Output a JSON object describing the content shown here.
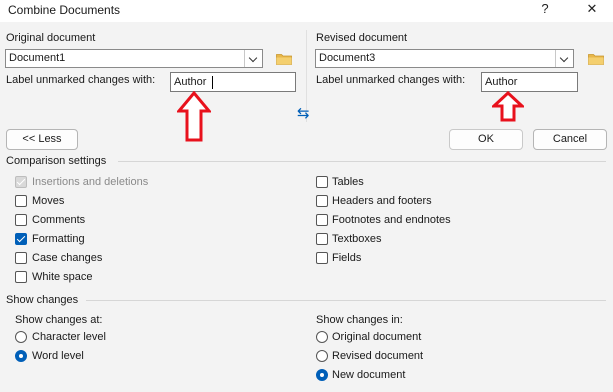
{
  "window": {
    "title": "Combine Documents",
    "help_glyph": "?",
    "close_glyph": "✕"
  },
  "original": {
    "section_label": "Original document",
    "document_value": "Document1",
    "label_prompt": "Label unmarked changes with:",
    "label_value": "Author"
  },
  "revised": {
    "section_label": "Revised document",
    "document_value": "Document3",
    "label_prompt": "Label unmarked changes with:",
    "label_value": "Author"
  },
  "swap_glyph": "⇆",
  "buttons": {
    "less": "<< Less",
    "ok": "OK",
    "cancel": "Cancel"
  },
  "comparison": {
    "heading": "Comparison settings",
    "left": [
      {
        "label": "Insertions and deletions",
        "checked": true,
        "disabled": true
      },
      {
        "label": "Moves",
        "checked": false
      },
      {
        "label": "Comments",
        "checked": false
      },
      {
        "label": "Formatting",
        "checked": true
      },
      {
        "label": "Case changes",
        "checked": false
      },
      {
        "label": "White space",
        "checked": false
      }
    ],
    "right": [
      {
        "label": "Tables",
        "checked": false
      },
      {
        "label": "Headers and footers",
        "checked": false
      },
      {
        "label": "Footnotes and endnotes",
        "checked": false
      },
      {
        "label": "Textboxes",
        "checked": false
      },
      {
        "label": "Fields",
        "checked": false
      }
    ]
  },
  "show_changes": {
    "heading": "Show changes",
    "at_label": "Show changes at:",
    "at_options": [
      {
        "label": "Character level",
        "selected": false
      },
      {
        "label": "Word level",
        "selected": true
      }
    ],
    "in_label": "Show changes in:",
    "in_options": [
      {
        "label": "Original document",
        "selected": false
      },
      {
        "label": "Revised document",
        "selected": false
      },
      {
        "label": "New document",
        "selected": true
      }
    ]
  },
  "colors": {
    "accent": "#005fb8",
    "annotation_arrow": "#e8111c",
    "folder": "#e8b74a"
  }
}
